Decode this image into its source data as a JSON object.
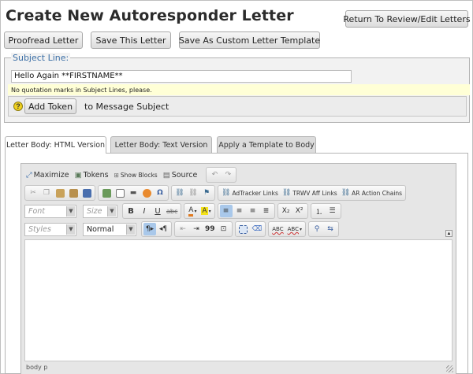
{
  "page": {
    "title": "Create New Autoresponder Letter"
  },
  "buttons": {
    "return": "Return To Review/Edit Letters",
    "proofread": "Proofread Letter",
    "save": "Save This Letter",
    "save_template": "Save As Custom Letter Template"
  },
  "subject": {
    "legend": "Subject Line:",
    "value": "Hello Again **FIRSTNAME**",
    "warning": "No quotation marks in Subject Lines, please.",
    "add_token": "Add Token",
    "token_target": "to Message Subject",
    "help_glyph": "?"
  },
  "tabs": [
    {
      "label": "Letter Body: HTML Version"
    },
    {
      "label": "Letter Body: Text Version"
    },
    {
      "label": "Apply a Template to Body"
    }
  ],
  "toolbar": {
    "maximize": "Maximize",
    "tokens": "Tokens",
    "show_blocks": "Show Blocks",
    "source": "Source",
    "adtracker": "AdTracker Links",
    "trwv": "TRWV Aff Links",
    "ar_chains": "AR Action Chains",
    "font_placeholder": "Font",
    "size_placeholder": "Size",
    "styles_placeholder": "Styles",
    "format_value": "Normal",
    "bold": "B",
    "italic": "I",
    "underline": "U",
    "strike": "abc",
    "subscript": "X₂",
    "superscript": "X²",
    "quote": "99",
    "spell1": "ABC",
    "spell2": "ABC"
  },
  "status": {
    "path": "body  p"
  },
  "icons": [
    "maximize-icon",
    "tokens-icon",
    "show-blocks-icon",
    "source-icon",
    "undo-icon",
    "redo-icon",
    "cut-icon",
    "copy-icon",
    "paste-icon",
    "paste-text-icon",
    "paste-word-icon",
    "image-icon",
    "table-icon",
    "horizontal-rule-icon",
    "smiley-icon",
    "special-char-icon",
    "link-icon",
    "unlink-icon",
    "anchor-icon",
    "text-color-icon",
    "bg-color-icon",
    "align-left-icon",
    "align-center-icon",
    "align-right-icon",
    "justify-icon",
    "numbered-list-icon",
    "bullet-list-icon",
    "ltr-icon",
    "rtl-icon",
    "outdent-icon",
    "indent-icon",
    "blockquote-icon",
    "div-icon",
    "select-all-icon",
    "remove-format-icon",
    "spellcheck-icon",
    "scayt-icon",
    "find-icon",
    "replace-icon",
    "collapse-icon",
    "help-icon"
  ]
}
